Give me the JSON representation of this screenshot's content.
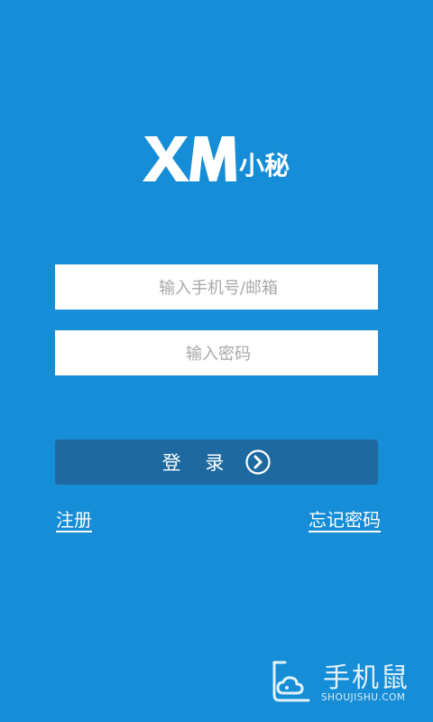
{
  "app": {
    "logo_text": "XM小秘",
    "background_color": "#158dd7",
    "button_color": "#1e6aa0"
  },
  "form": {
    "phone_placeholder": "输入手机号/邮箱",
    "phone_value": "",
    "password_placeholder": "输入密码",
    "password_value": "",
    "login_label": "登 录",
    "login_icon": "chevron-right-circle-icon"
  },
  "links": {
    "register": "注册",
    "forgot_password": "忘记密码"
  },
  "watermark": {
    "title": "手机鼠",
    "domain": "SHOUJISHU.COM",
    "icon": "mouse-cloud-icon"
  }
}
